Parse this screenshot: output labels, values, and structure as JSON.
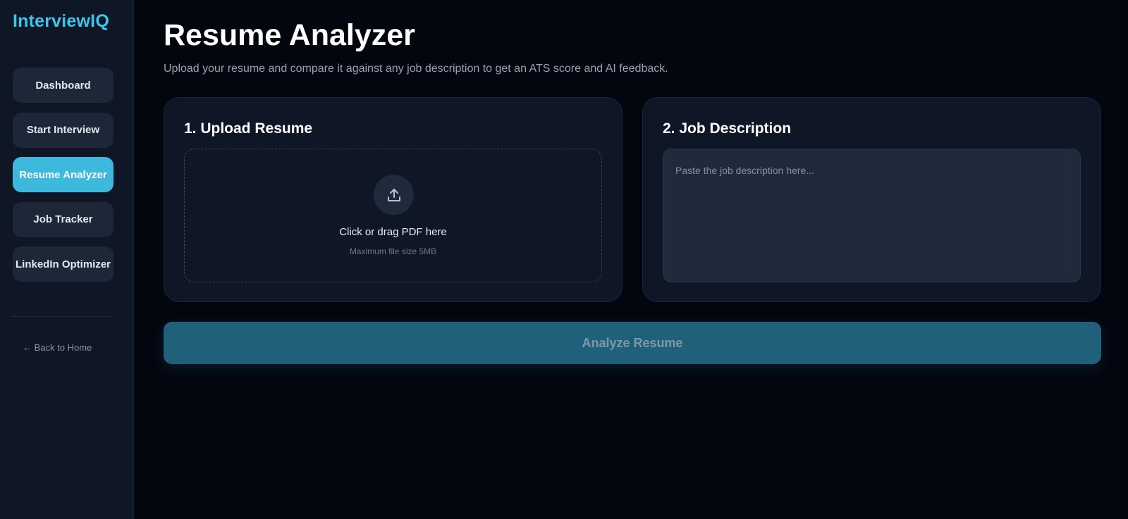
{
  "brand": "InterviewIQ",
  "sidebar": {
    "items": [
      {
        "label": "Dashboard",
        "active": false
      },
      {
        "label": "Start Interview",
        "active": false
      },
      {
        "label": "Resume Analyzer",
        "active": true
      },
      {
        "label": "Job Tracker",
        "active": false
      },
      {
        "label": "LinkedIn Optimizer",
        "active": false
      }
    ],
    "back_link": "← Back to Home"
  },
  "main": {
    "title": "Resume Analyzer",
    "subtitle": "Upload your resume and compare it against any job description to get an ATS score and AI feedback.",
    "upload_card": {
      "title": "1. Upload Resume",
      "drop_text": "Click or drag PDF here",
      "drop_hint": "Maximum file size 5MB",
      "icon": "upload-icon"
    },
    "jd_card": {
      "title": "2. Job Description",
      "placeholder": "Paste the job description here...",
      "value": ""
    },
    "analyze_button": "Analyze Resume"
  },
  "colors": {
    "accent": "#3cb9dd",
    "brand": "#3ec5e8",
    "background": "#03060f",
    "card": "#0f1626",
    "button_disabled": "#21607a"
  }
}
